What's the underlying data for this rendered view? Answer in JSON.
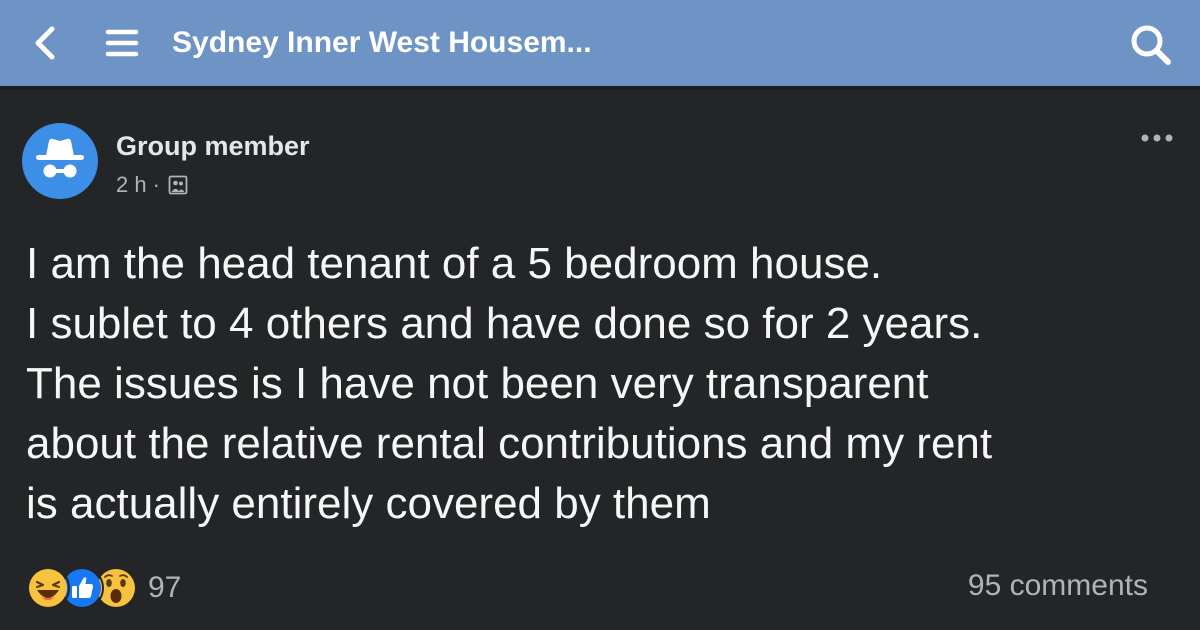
{
  "header": {
    "group_title": "Sydney Inner West Housem...",
    "back_icon": "back-chevron-icon",
    "menu_icon": "hamburger-menu-icon",
    "search_icon": "search-icon",
    "bar_color": "#6e93c5"
  },
  "post": {
    "author": "Group member",
    "avatar_icon": "anonymous-incognito-icon",
    "time": "2 h",
    "separator": "·",
    "audience_icon": "group-audience-icon",
    "more_icon": "more-options-icon",
    "lines": [
      "I am the head tenant of a 5 bedroom house.",
      "I sublet to 4 others and have done so for 2 years.",
      "The issues is I have not been very transparent",
      "about the relative rental contributions and my rent",
      "is actually entirely covered by them"
    ]
  },
  "footer": {
    "reaction_icons": [
      "haha-reaction-icon",
      "like-reaction-icon",
      "wow-reaction-icon"
    ],
    "reaction_count": "97",
    "comments": "95 comments"
  }
}
